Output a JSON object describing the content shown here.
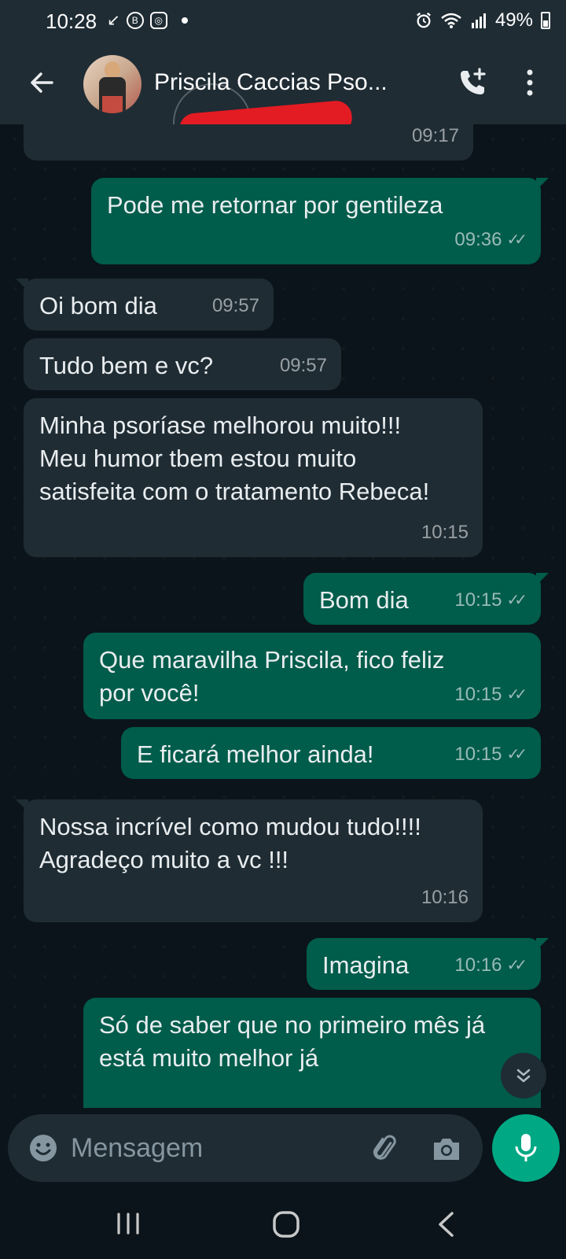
{
  "status_bar": {
    "time": "10:28",
    "battery": "49%",
    "icons": [
      "missed-call-icon",
      "b-icon",
      "instagram-icon",
      "dot-icon",
      "alarm-icon",
      "wifi-icon",
      "signal-icon",
      "battery-icon"
    ]
  },
  "header": {
    "contact_name": "Priscila Caccias Pso...",
    "redacted": true
  },
  "messages": [
    {
      "dir": "in",
      "text": "",
      "time": "09:17"
    },
    {
      "dir": "out",
      "text": "Pode me retornar por gentileza",
      "time": "09:36"
    },
    {
      "dir": "in",
      "text": "Oi bom dia",
      "time": "09:57"
    },
    {
      "dir": "in",
      "text": "Tudo bem e vc?",
      "time": "09:57"
    },
    {
      "dir": "in",
      "text": "Minha psoríase melhorou muito!!! Meu humor tbem estou muito satisfeita com o tratamento Rebeca!",
      "time": "10:15"
    },
    {
      "dir": "out",
      "text": "Bom dia",
      "time": "10:15"
    },
    {
      "dir": "out",
      "text": "Que maravilha Priscila, fico feliz por você!",
      "time": "10:15"
    },
    {
      "dir": "out",
      "text": "E ficará melhor ainda!",
      "time": "10:15"
    },
    {
      "dir": "in",
      "text": "Nossa incrível como mudou tudo!!!! Agradeço muito a vc !!!",
      "time": "10:16"
    },
    {
      "dir": "out",
      "text": "Imagina",
      "time": "10:16"
    },
    {
      "dir": "out",
      "text": "Só de saber que no primeiro mês já está muito melhor  já ",
      "time": ""
    }
  ],
  "composer": {
    "placeholder": "Mensagem"
  },
  "colors": {
    "background": "#0b141a",
    "header": "#1f2c34",
    "bubble_in": "#1f2c34",
    "bubble_out": "#005c4b",
    "accent": "#00a884"
  }
}
